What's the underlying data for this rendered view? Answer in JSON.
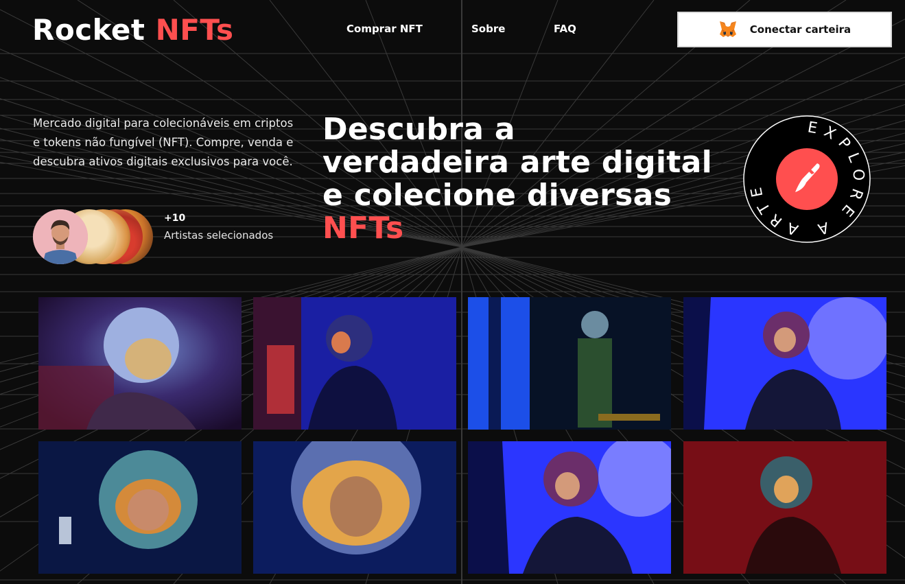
{
  "header": {
    "logo_main": "Rocket",
    "logo_accent": "NFTs",
    "nav": [
      "Comprar NFT",
      "Sobre",
      "FAQ"
    ],
    "wallet_button": "Conectar carteira",
    "wallet_icon": "metamask-fox-icon"
  },
  "hero": {
    "description": "Mercado digital para colecionáveis em criptos e tokens não fungível (NFT). Compre, venda e descubra ativos digitais exclusivos para você.",
    "artists_count": "+10",
    "artists_label": "Artistas selecionados",
    "headline_lines": [
      "Descubra a",
      "verdadeira arte digital",
      "e colecione diversas"
    ],
    "headline_accent": "NFTs",
    "badge_text": "EXPLORE A ARTE",
    "badge_icon": "brush-icon"
  },
  "colors": {
    "accent": "#ff4f4f",
    "background": "#0c0c0c",
    "text": "#ffffff"
  }
}
